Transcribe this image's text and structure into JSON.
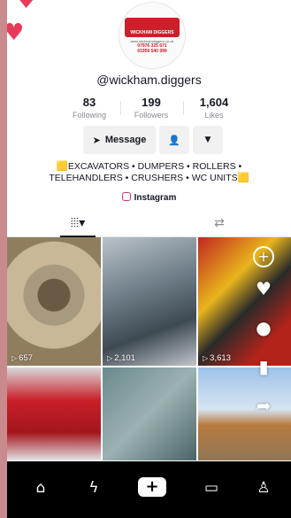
{
  "profile": {
    "username": "@wickham.diggers",
    "avatar_text": {
      "brand": "WICKHAM DIGGERS",
      "website": "www.wickhamdiggers.co.uk",
      "phone_1": "07976 325 671",
      "phone_2": "01959 540 999"
    }
  },
  "stats": [
    {
      "value": "83",
      "label": "Following"
    },
    {
      "value": "199",
      "label": "Followers"
    },
    {
      "value": "1,604",
      "label": "Likes"
    }
  ],
  "actions": {
    "message_label": "Message",
    "message_icon": "send-icon",
    "follow_icon": "person-add-icon",
    "more_icon": "caret-down-icon"
  },
  "bio": {
    "line1": "🟨EXCAVATORS • DUMPERS • ROLLERS •",
    "line2": "TELEHANDLERS • CRUSHERS • WC UNITS🟨",
    "link_label": "Instagram"
  },
  "tabs": [
    {
      "name": "videos",
      "icon": "grid-icon",
      "glyph": "⦙⦙⦙▾"
    },
    {
      "name": "reposts",
      "icon": "repost-icon",
      "glyph": "⇄"
    }
  ],
  "videos": [
    {
      "views": "657"
    },
    {
      "views": "2,101"
    },
    {
      "views": "3,613"
    },
    {
      "views": ""
    },
    {
      "views": ""
    },
    {
      "views": ""
    }
  ],
  "side_actions": [
    "add-circle-icon",
    "heart-icon",
    "comment-icon",
    "bookmark-icon",
    "share-icon"
  ],
  "nav": [
    {
      "name": "home",
      "glyph": "⌂"
    },
    {
      "name": "discover",
      "glyph": "ϟ"
    },
    {
      "name": "create",
      "glyph": "+"
    },
    {
      "name": "inbox",
      "glyph": "▭"
    },
    {
      "name": "profile",
      "glyph": "♙"
    }
  ],
  "colors": {
    "accent": "#c9202a",
    "nav_bg": "#000000",
    "border": "#c98a8e"
  }
}
